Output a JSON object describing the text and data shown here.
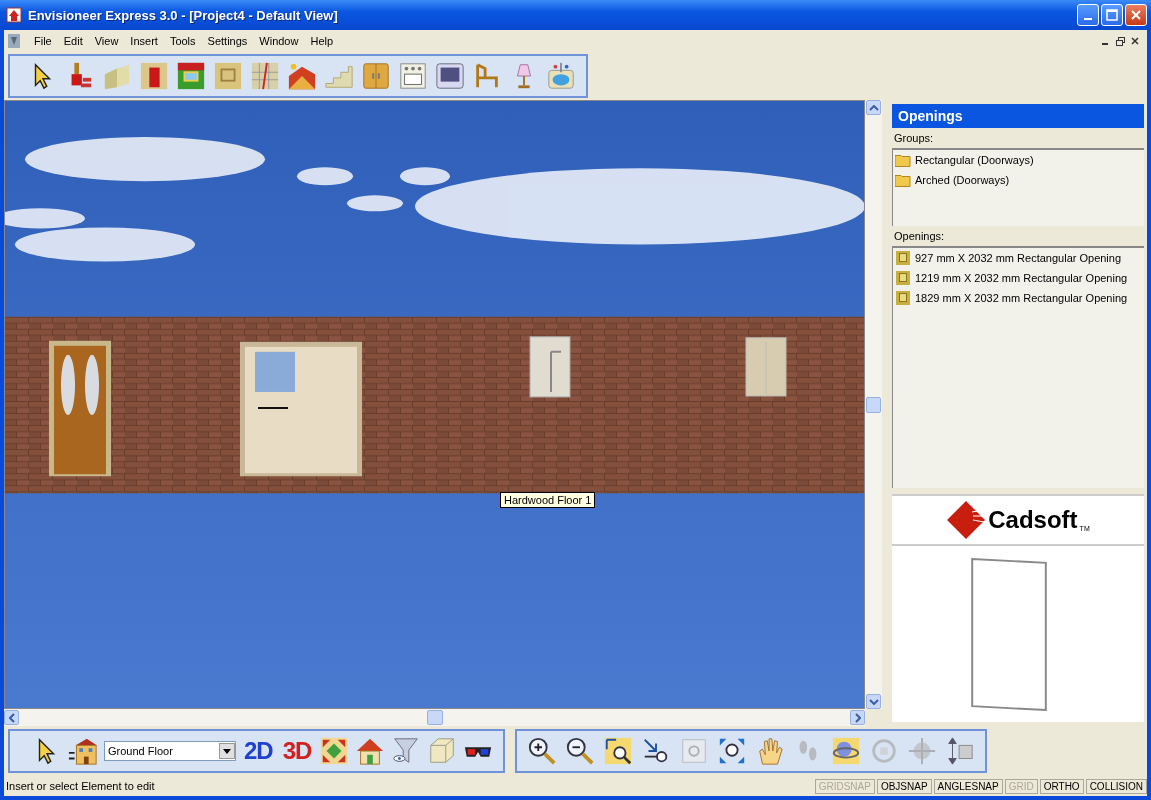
{
  "window": {
    "title": "Envisioneer Express 3.0 - [Project4 - Default View]"
  },
  "menu": [
    "File",
    "Edit",
    "View",
    "Insert",
    "Tools",
    "Settings",
    "Window",
    "Help"
  ],
  "viewport": {
    "tooltip": "Hardwood Floor 1"
  },
  "panel": {
    "title": "Openings",
    "groups_label": "Groups:",
    "groups": [
      "Rectangular (Doorways)",
      "Arched (Doorways)"
    ],
    "openings_label": "Openings:",
    "openings": [
      "927 mm X 2032 mm Rectangular Opening",
      "1219 mm X 2032 mm Rectangular Opening",
      "1829 mm X 2032 mm Rectangular Opening"
    ],
    "logo": {
      "name": "Cadsoft",
      "mark": "TM"
    }
  },
  "bottom_toolbar": {
    "floor": "Ground Floor",
    "view_2d": "2D",
    "view_3d": "3D"
  },
  "status_bar": {
    "message": "Insert or select Element to edit",
    "indicators": [
      {
        "label": "GRIDSNAP",
        "on": false
      },
      {
        "label": "OBJSNAP",
        "on": true
      },
      {
        "label": "ANGLESNAP",
        "on": true
      },
      {
        "label": "GRID",
        "on": false
      },
      {
        "label": "ORTHO",
        "on": true
      },
      {
        "label": "COLLISION",
        "on": true
      }
    ]
  }
}
